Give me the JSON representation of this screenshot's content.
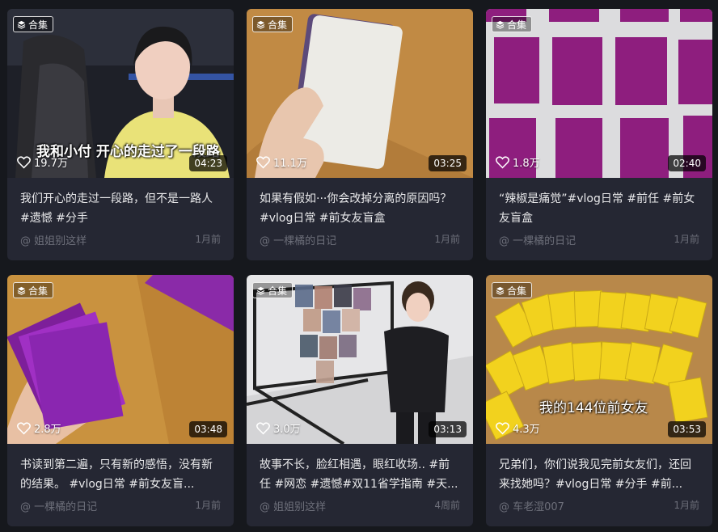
{
  "cards": [
    {
      "badge": "合集",
      "likes": "19.7万",
      "duration": "04:23",
      "title": "我们开心的走过一段路，但不是一路人#遗憾 #分手",
      "author": "@ 姐姐别这样",
      "time": "1月前",
      "overlay_text": "我和小付 开心的走过了一段路"
    },
    {
      "badge": "合集",
      "likes": "11.1万",
      "duration": "03:25",
      "title": "如果有假如···你会改掉分离的原因吗？ #vlog日常 #前女友盲盒",
      "author": "@ 一棵橘的日记",
      "time": "1月前"
    },
    {
      "badge": "合集",
      "likes": "1.8万",
      "duration": "02:40",
      "title": "“辣椒是痛觉”#vlog日常 #前任 #前女友盲盒",
      "author": "@ 一棵橘的日记",
      "time": "1月前"
    },
    {
      "badge": "合集",
      "likes": "2.8万",
      "duration": "03:48",
      "title": "书读到第二遍，只有新的感悟，没有新的结果。 #vlog日常 #前女友盲...",
      "author": "@ 一棵橘的日记",
      "time": "1月前"
    },
    {
      "badge": "合集",
      "likes": "3.0万",
      "duration": "03:13",
      "title": "故事不长，脸红相遇，眼红收场.. #前任 #网恋 #遗憾#双11省学指南 #天...",
      "author": "@ 姐姐别这样",
      "time": "4周前"
    },
    {
      "badge": "合集",
      "likes": "4.3万",
      "duration": "03:53",
      "title": "兄弟们，你们说我见完前女友们，还回来找她吗？#vlog日常 #分手 #前...",
      "author": "@ 车老湿007",
      "time": "1月前",
      "overlay_text": "我的144位前女友"
    }
  ]
}
